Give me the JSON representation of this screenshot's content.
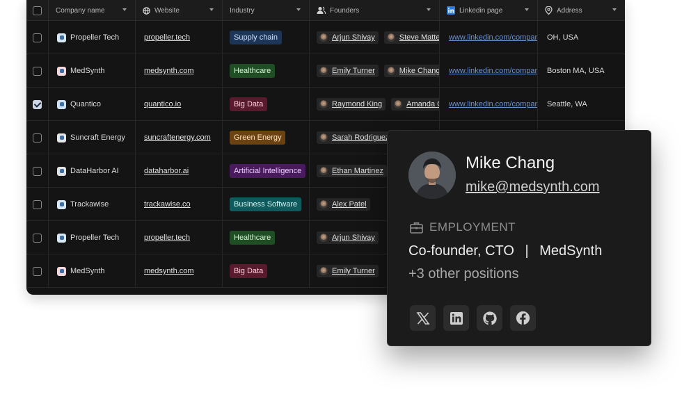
{
  "headers": {
    "company": "Company name",
    "website": "Website",
    "industry": "Industry",
    "founders": "Founders",
    "linkedin": "Linkedin page",
    "address": "Address"
  },
  "rows": [
    {
      "checked": false,
      "company": "Propeller Tech",
      "website": "propeller.tech",
      "industry": "Supply chain",
      "ind_bg": "#1d3557",
      "ind_fg": "#cfe0ff",
      "f1": "Arjun Shivay",
      "f2": "Steve Mattes",
      "linkedin": "www.linkedin.com/company",
      "address": "OH, USA",
      "logo_color": "#d9e8f0"
    },
    {
      "checked": false,
      "company": "MedSynth",
      "website": "medsynth.com",
      "industry": "Healthcare",
      "ind_bg": "#1f4d24",
      "ind_fg": "#d6f5d6",
      "f1": "Emily Turner",
      "f2": "Mike Chang",
      "linkedin": "www.linkedin.com/company",
      "address": "Boston MA, USA",
      "logo_color": "#f2d7dc"
    },
    {
      "checked": true,
      "company": "Quantico",
      "website": "quantico.io",
      "industry": "Big Data",
      "ind_bg": "#5a1a2e",
      "ind_fg": "#ffd0dc",
      "f1": "Raymond King",
      "f2": "Amanda C",
      "linkedin": "www.linkedin.com/company",
      "address": "Seattle, WA",
      "logo_color": "#cfe0f5"
    },
    {
      "checked": false,
      "company": "Suncraft Energy",
      "website": "suncraftenergy.com",
      "industry": "Green Energy",
      "ind_bg": "#6b4212",
      "ind_fg": "#ffe3c0",
      "f1": "Sarah Rodriguez",
      "f2": "",
      "linkedin": "",
      "address": "",
      "logo_color": "#e6e6e6"
    },
    {
      "checked": false,
      "company": "DataHarbor AI",
      "website": "dataharbor.ai",
      "industry": "Artificial Intelligence",
      "ind_bg": "#4a1a5e",
      "ind_fg": "#ecd0ff",
      "f1": "Ethan Martinez",
      "f2": "",
      "linkedin": "",
      "address": "",
      "logo_color": "#e2e2e2"
    },
    {
      "checked": false,
      "company": "Trackawise",
      "website": "trackawise.co",
      "industry": "Business Software",
      "ind_bg": "#0f5a5c",
      "ind_fg": "#cff5f5",
      "f1": "Alex Patel",
      "f2": "",
      "linkedin": "",
      "address": "",
      "logo_color": "#d9e8f5"
    },
    {
      "checked": false,
      "company": "Propeller Tech",
      "website": "propeller.tech",
      "industry": "Healthcare",
      "ind_bg": "#1f4d24",
      "ind_fg": "#d6f5d6",
      "f1": "Arjun Shivay",
      "f2": "",
      "linkedin": "",
      "address": "",
      "logo_color": "#d9e8f0"
    },
    {
      "checked": false,
      "company": "MedSynth",
      "website": "medsynth.com",
      "industry": "Big Data",
      "ind_bg": "#5a1a2e",
      "ind_fg": "#ffd0dc",
      "f1": "Emily Turner",
      "f2": "",
      "linkedin": "",
      "address": "",
      "logo_color": "#f2d7dc"
    }
  ],
  "card": {
    "name": "Mike Chang",
    "email": "mike@medsynth.com",
    "section": "EMPLOYMENT",
    "role": "Co-founder, CTO",
    "separator": "|",
    "company": "MedSynth",
    "other": "+3 other positions",
    "socials": [
      "x-icon",
      "linkedin-icon",
      "github-icon",
      "facebook-icon"
    ]
  }
}
